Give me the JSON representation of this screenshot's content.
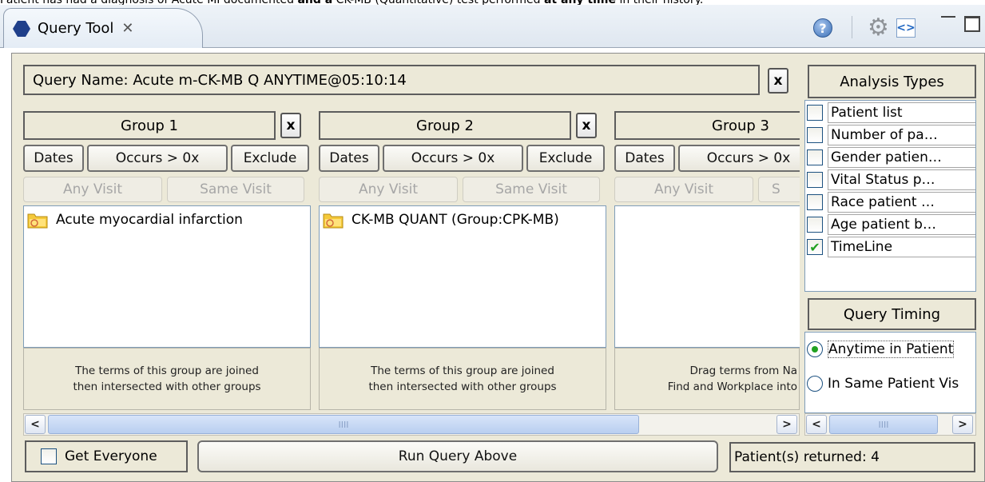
{
  "caption": {
    "prefix": "Patient has had a diagnosis of Acute MI documented ",
    "emph1": "and a",
    "middle": " CK-MB (Quantitative) test performed ",
    "emph2": "at any time",
    "suffix": " in their history."
  },
  "tab": {
    "title": "Query Tool",
    "close": "✕"
  },
  "toolbar": {
    "help": "?",
    "gear": "⚙",
    "link": "<>"
  },
  "query": {
    "name": "Query Name: Acute m-CK-MB Q ANYTIME@05:10:14",
    "clear": "x"
  },
  "groups": [
    {
      "title": "Group 1",
      "clear": "x",
      "dates": "Dates",
      "occurs": "Occurs > 0x",
      "exclude": "Exclude",
      "any_visit": "Any Visit",
      "same_visit": "Same Visit",
      "term": "Acute myocardial infarction",
      "hint1": "The terms of this group are joined",
      "hint2": "then intersected with other groups"
    },
    {
      "title": "Group 2",
      "clear": "x",
      "dates": "Dates",
      "occurs": "Occurs > 0x",
      "exclude": "Exclude",
      "any_visit": "Any Visit",
      "same_visit": "Same Visit",
      "term": "CK-MB QUANT (Group:CPK-MB)",
      "hint1": "The terms of this group are joined",
      "hint2": "then intersected with other groups"
    },
    {
      "title": "Group 3",
      "dates": "Dates",
      "occurs": "Occurs > 0x",
      "any_visit": "Any Visit",
      "same_visit": "S",
      "hint1": "Drag terms from Na",
      "hint2": "Find and Workplace into"
    }
  ],
  "scroll": {
    "left": "<",
    "right": ">",
    "grip": "IIII"
  },
  "analysis": {
    "title": "Analysis Types",
    "items": [
      {
        "label": "Patient list",
        "checked": false
      },
      {
        "label": "Number of pa…",
        "checked": false
      },
      {
        "label": "Gender patien…",
        "checked": false
      },
      {
        "label": "Vital Status p…",
        "checked": false
      },
      {
        "label": "Race patient …",
        "checked": false
      },
      {
        "label": "Age patient b…",
        "checked": false
      },
      {
        "label": "TimeLine",
        "checked": true
      }
    ],
    "check_mark": "✔"
  },
  "timing": {
    "title": "Query Timing",
    "options": [
      {
        "label": "Anytime in Patient",
        "selected": true
      },
      {
        "label": "In Same Patient Vis",
        "selected": false
      }
    ]
  },
  "footer": {
    "get_everyone": "Get Everyone",
    "run": "Run Query Above",
    "patients_returned": "Patient(s) returned: 4"
  },
  "colors": {
    "panel_bg": "#ece9d8",
    "check_green": "#21a121",
    "tab_icon": "#1f3f8a",
    "folder_yellow": "#f5c93a"
  }
}
